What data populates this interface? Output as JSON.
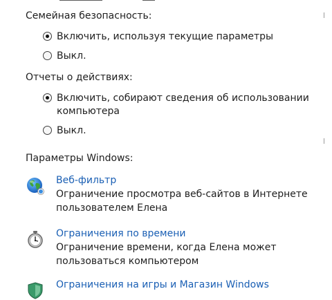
{
  "family_safety": {
    "label": "Семейная безопасность:",
    "options": [
      {
        "label": "Включить, используя текущие параметры",
        "selected": true
      },
      {
        "label": "Выкл.",
        "selected": false
      }
    ]
  },
  "activity_reports": {
    "label": "Отчеты о действиях:",
    "options": [
      {
        "label": "Включить, собирают сведения об использовании компьютера",
        "selected": true
      },
      {
        "label": "Выкл.",
        "selected": false
      }
    ]
  },
  "windows_settings": {
    "label": "Параметры Windows:",
    "items": [
      {
        "icon": "globe-icon",
        "title": "Веб-фильтр",
        "description": "Ограничение просмотра веб-сайтов в Интернете пользователем Елена"
      },
      {
        "icon": "stopwatch-icon",
        "title": "Ограничения по времени",
        "description": "Ограничение времени, когда Елена может пользоваться компьютером"
      },
      {
        "icon": "shield-icon",
        "title": "Ограничения на игры и Магазин Windows",
        "description": ""
      }
    ]
  },
  "colors": {
    "link": "#1a5fb4",
    "text": "#1e1e1e"
  }
}
